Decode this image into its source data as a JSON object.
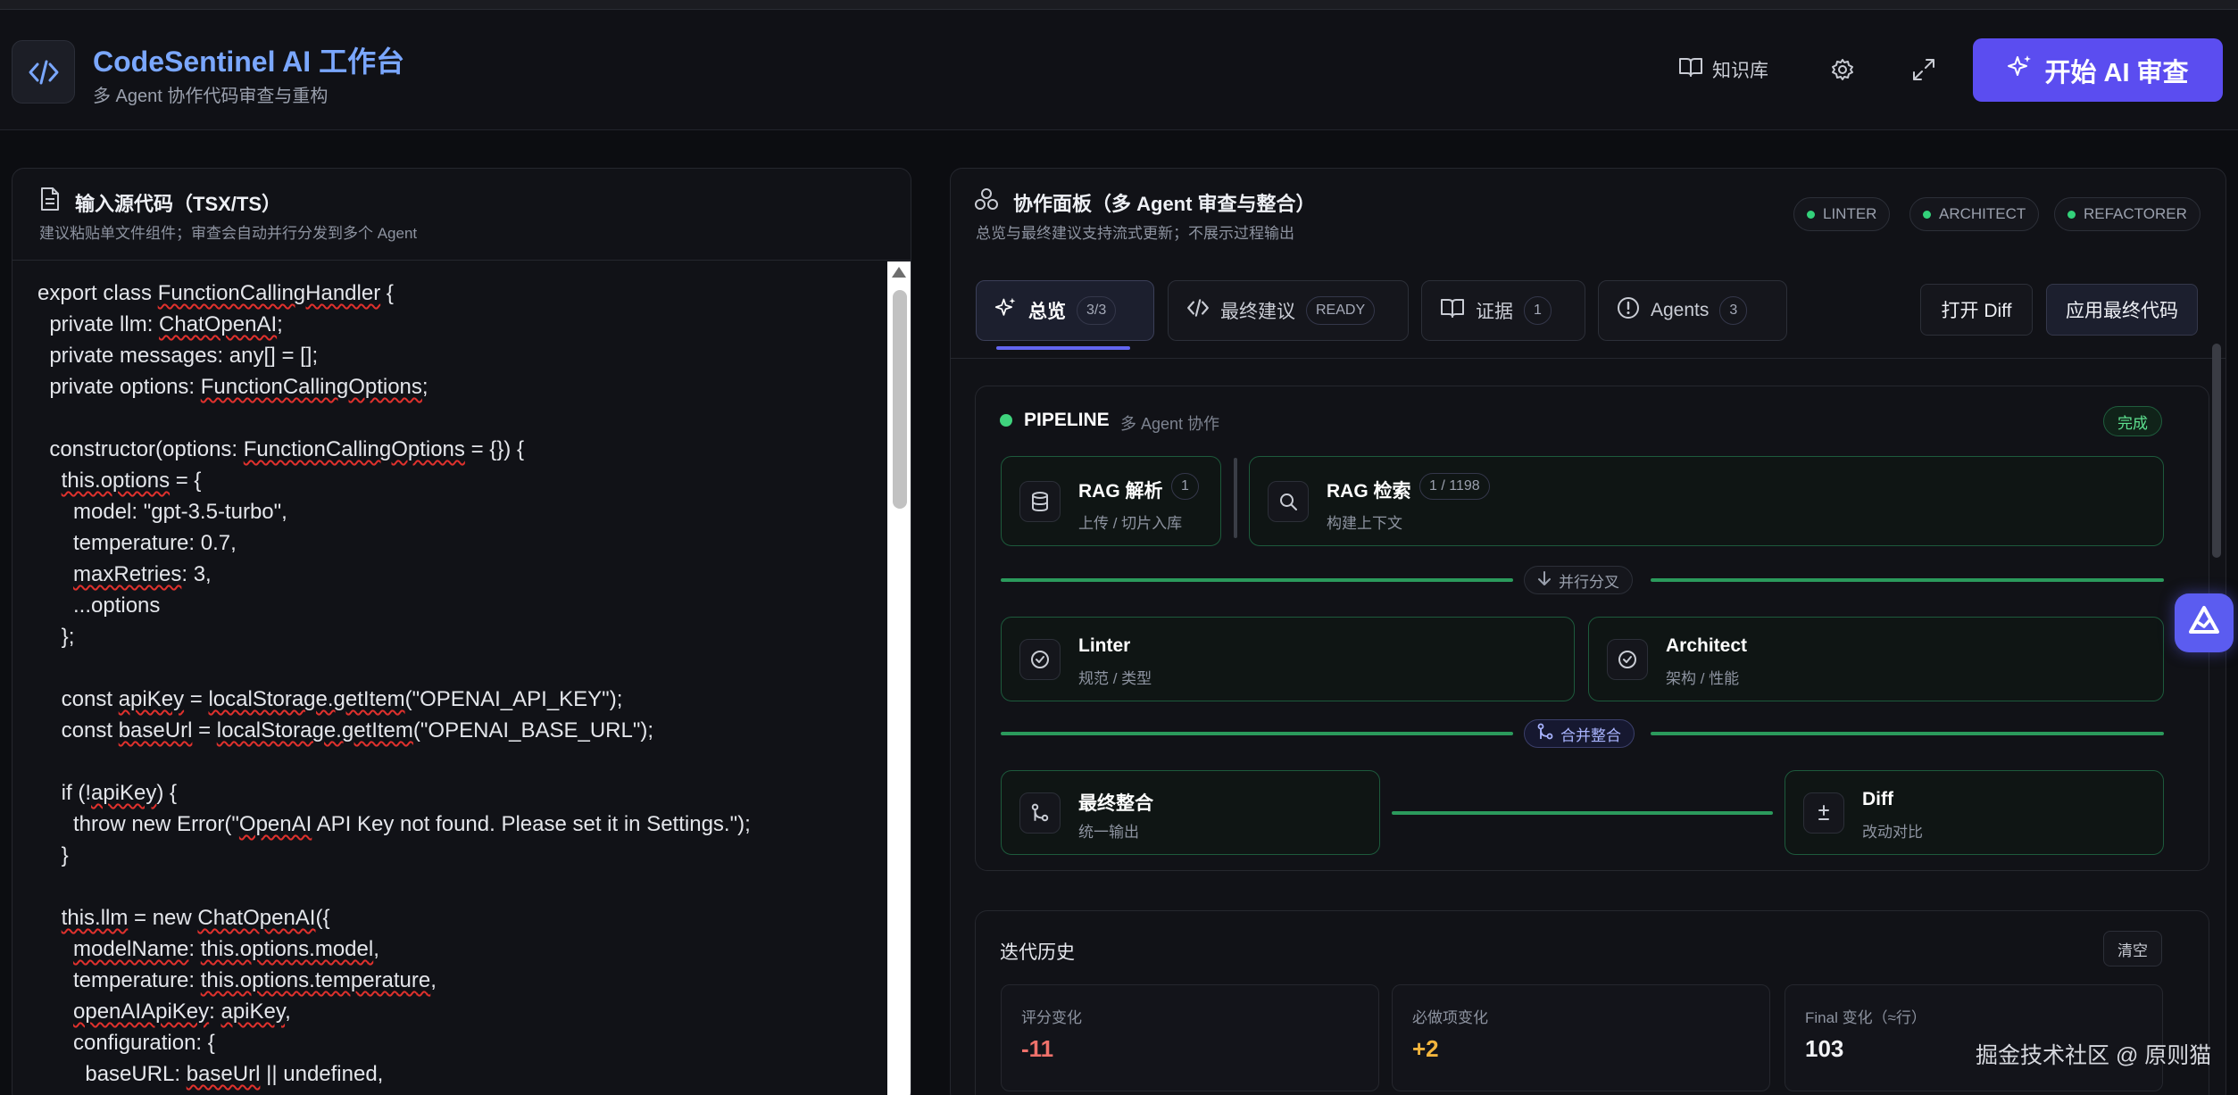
{
  "header": {
    "title": "CodeSentinel AI 工作台",
    "subtitle": "多 Agent 协作代码审查与重构",
    "kb_label": "知识库",
    "start_label": "开始 AI 审查"
  },
  "left_panel": {
    "title": "输入源代码（TSX/TS）",
    "subtitle": "建议粘贴单文件组件；审查会自动并行分发到多个 Agent",
    "code_lines": [
      "export class FunctionCallingHandler {",
      "  private llm: ChatOpenAI;",
      "  private messages: any[] = [];",
      "  private options: FunctionCallingOptions;",
      "",
      "  constructor(options: FunctionCallingOptions = {}) {",
      "    this.options = {",
      "      model: \"gpt-3.5-turbo\",",
      "      temperature: 0.7,",
      "      maxRetries: 3,",
      "      ...options",
      "    };",
      "",
      "    const apiKey = localStorage.getItem(\"OPENAI_API_KEY\");",
      "    const baseUrl = localStorage.getItem(\"OPENAI_BASE_URL\");",
      "",
      "    if (!apiKey) {",
      "      throw new Error(\"OpenAI API Key not found. Please set it in Settings.\");",
      "    }",
      "",
      "    this.llm = new ChatOpenAI({",
      "      modelName: this.options.model,",
      "      temperature: this.options.temperature,",
      "      openAIApiKey: apiKey,",
      "      configuration: {",
      "        baseURL: baseUrl || undefined,"
    ]
  },
  "right_panel": {
    "title": "协作面板（多 Agent 审查与整合）",
    "subtitle": "总览与最终建议支持流式更新；不展示过程输出",
    "agents": [
      "LINTER",
      "ARCHITECT",
      "REFACTORER"
    ],
    "tabs": [
      {
        "label": "总览",
        "badge": "3/3"
      },
      {
        "label": "最终建议",
        "badge": "READY"
      },
      {
        "label": "证据",
        "badge": "1"
      },
      {
        "label": "Agents",
        "badge": "3"
      }
    ],
    "open_diff_label": "打开 Diff",
    "apply_label": "应用最终代码"
  },
  "pipeline": {
    "title": "PIPELINE",
    "subtitle": "多 Agent 协作",
    "status": "完成",
    "rag_parse": {
      "title": "RAG 解析",
      "badge": "1",
      "sub": "上传 / 切片入库"
    },
    "rag_search": {
      "title": "RAG 检索",
      "badge": "1 / 1198",
      "sub": "构建上下文"
    },
    "fork_label": "并行分叉",
    "linter": {
      "title": "Linter",
      "sub": "规范 / 类型"
    },
    "architect": {
      "title": "Architect",
      "sub": "架构 / 性能"
    },
    "merge_label": "合并整合",
    "final": {
      "title": "最终整合",
      "sub": "统一输出"
    },
    "diff": {
      "title": "Diff",
      "sub": "改动对比"
    }
  },
  "history": {
    "title": "迭代历史",
    "clear_label": "清空",
    "stats": [
      {
        "label": "评分变化",
        "value": "-11",
        "color": "#f0716b"
      },
      {
        "label": "必做项变化",
        "value": "+2",
        "color": "#f3b53d"
      },
      {
        "label": "Final 变化（≈行）",
        "value": "103",
        "color": "#f2f3f6"
      }
    ]
  },
  "watermark": "掘金技术社区 @ 原则猫",
  "colors": {
    "accent": "#5b4df0",
    "success": "#33d17a",
    "title_blue": "#7aa7ff"
  }
}
